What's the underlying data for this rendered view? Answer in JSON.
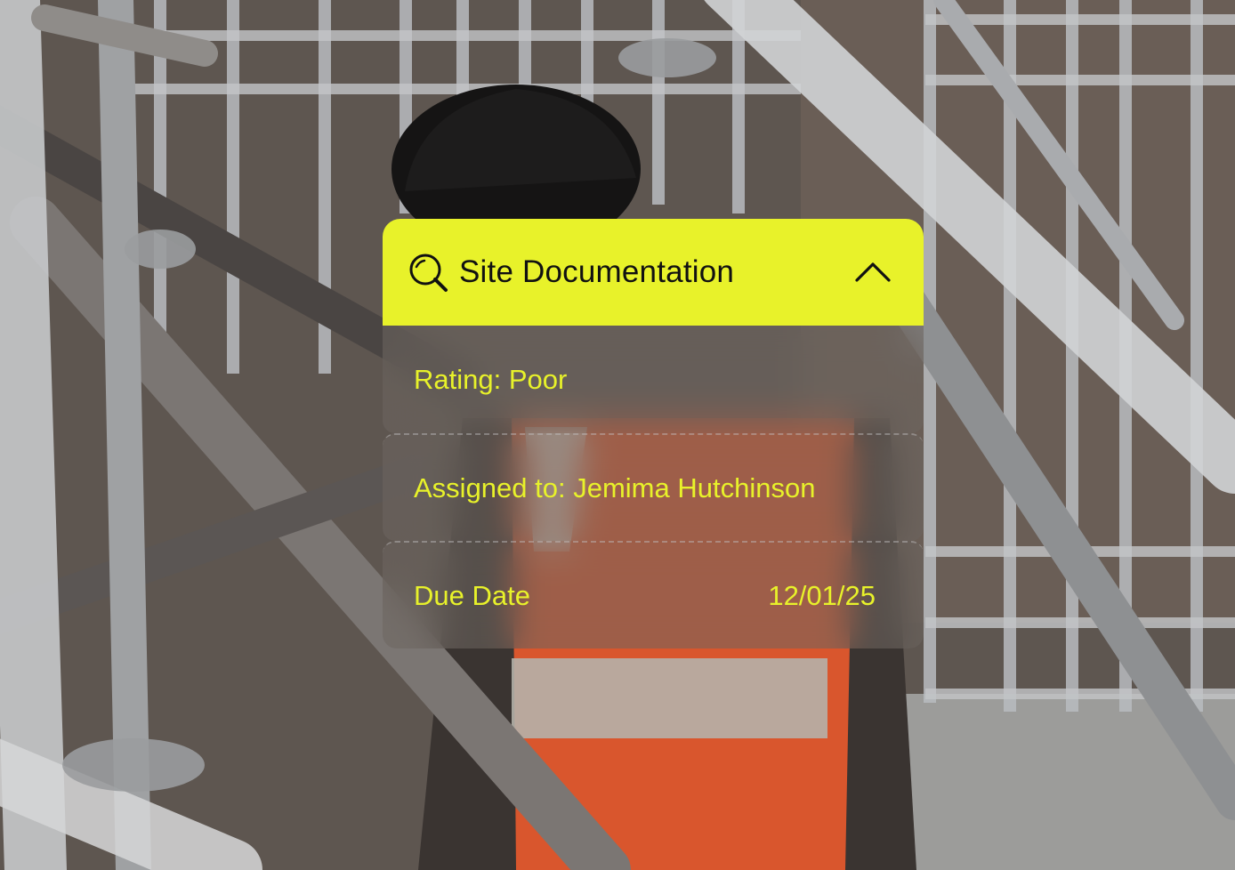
{
  "card": {
    "title": "Site Documentation",
    "header_icon": "search-icon",
    "toggle_icon": "chevron-up-icon",
    "accent_color": "#e8f22a",
    "rows": [
      {
        "label": "Rating: Poor"
      },
      {
        "label": "Assigned to: Jemima Hutchinson"
      },
      {
        "label": "Due Date",
        "value": "12/01/25"
      }
    ]
  }
}
